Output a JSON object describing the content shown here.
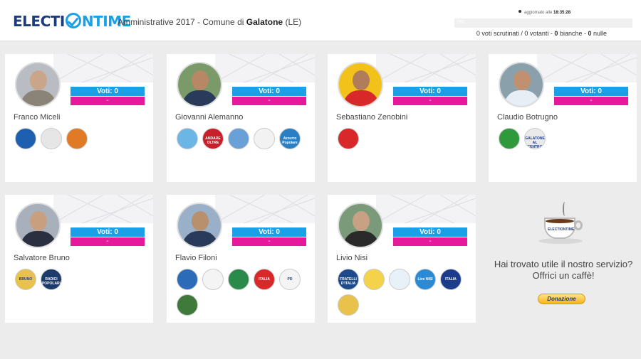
{
  "brand": {
    "part1": "ELECTI",
    "part2": "NTIME"
  },
  "header": {
    "title_prefix": "Amministrative 2017 - Comune di ",
    "title_town": "Galatone",
    "title_suffix": " (LE)",
    "updated_label": "aggiornato alle",
    "updated_time": "18:35:28",
    "progress_label": "0%",
    "voti_scrutinati": "0 voti scrutinati / 0 votanti - ",
    "bianche_num": "0",
    "bianche_label": " bianche - ",
    "nulle_num": "0",
    "nulle_label": " nulle"
  },
  "candidates": [
    {
      "name": "Franco Miceli",
      "votes": "Voti: 0",
      "pct": "-",
      "lists": [
        {
          "label": "",
          "color": "#1e5fb0"
        },
        {
          "label": "",
          "color": "#e6e6e6"
        },
        {
          "label": "",
          "color": "#e07a24"
        }
      ]
    },
    {
      "name": "Giovanni Alemanno",
      "votes": "Voti: 0",
      "pct": "-",
      "lists": [
        {
          "label": "",
          "color": "#6cb6e6"
        },
        {
          "label": "ANDARE OLTRE",
          "color": "#c8202a"
        },
        {
          "label": "",
          "color": "#6aa0d8"
        },
        {
          "label": "",
          "color": "#f2f2f2"
        },
        {
          "label": "Azzurro Popolare",
          "color": "#2a7fc4"
        }
      ]
    },
    {
      "name": "Sebastiano Zenobini",
      "votes": "Voti: 0",
      "pct": "-",
      "lists": [
        {
          "label": "",
          "color": "#d8282a"
        }
      ]
    },
    {
      "name": "Claudio Botrugno",
      "votes": "Voti: 0",
      "pct": "-",
      "lists": [
        {
          "label": "",
          "color": "#2f9a3c"
        },
        {
          "label": "GALATONE AL CENTRO",
          "color": "#eaeaea"
        }
      ]
    },
    {
      "name": "Salvatore Bruno",
      "votes": "Voti: 0",
      "pct": "-",
      "lists": [
        {
          "label": "BRUNO",
          "color": "#e8c24a"
        },
        {
          "label": "RADICI POPOLARI",
          "color": "#1c3b6a"
        }
      ]
    },
    {
      "name": "Flavio Filoni",
      "votes": "Voti: 0",
      "pct": "-",
      "lists": [
        {
          "label": "",
          "color": "#2c6bb8"
        },
        {
          "label": "",
          "color": "#f4f4f4"
        },
        {
          "label": "",
          "color": "#2a8a4a"
        },
        {
          "label": "ITALIA",
          "color": "#d8282a"
        },
        {
          "label": "PD",
          "color": "#f4f4f4"
        },
        {
          "label": "",
          "color": "#3f7a3a"
        }
      ]
    },
    {
      "name": "Livio Nisi",
      "votes": "Voti: 0",
      "pct": "-",
      "lists": [
        {
          "label": "FRATELLI D'ITALIA",
          "color": "#1c4a8a"
        },
        {
          "label": "",
          "color": "#f4d24a"
        },
        {
          "label": "",
          "color": "#e8f0f8"
        },
        {
          "label": "Live NISI",
          "color": "#2a8ad6"
        },
        {
          "label": "ITALIA",
          "color": "#1c3b8a"
        },
        {
          "label": "",
          "color": "#e8c24a"
        }
      ]
    }
  ],
  "donation": {
    "line1": "Hai trovato utile il nostro servizio?",
    "line2": "Offrici un caffè!",
    "button": "Donazione",
    "cup_brand": "ELECTIONTIME"
  }
}
